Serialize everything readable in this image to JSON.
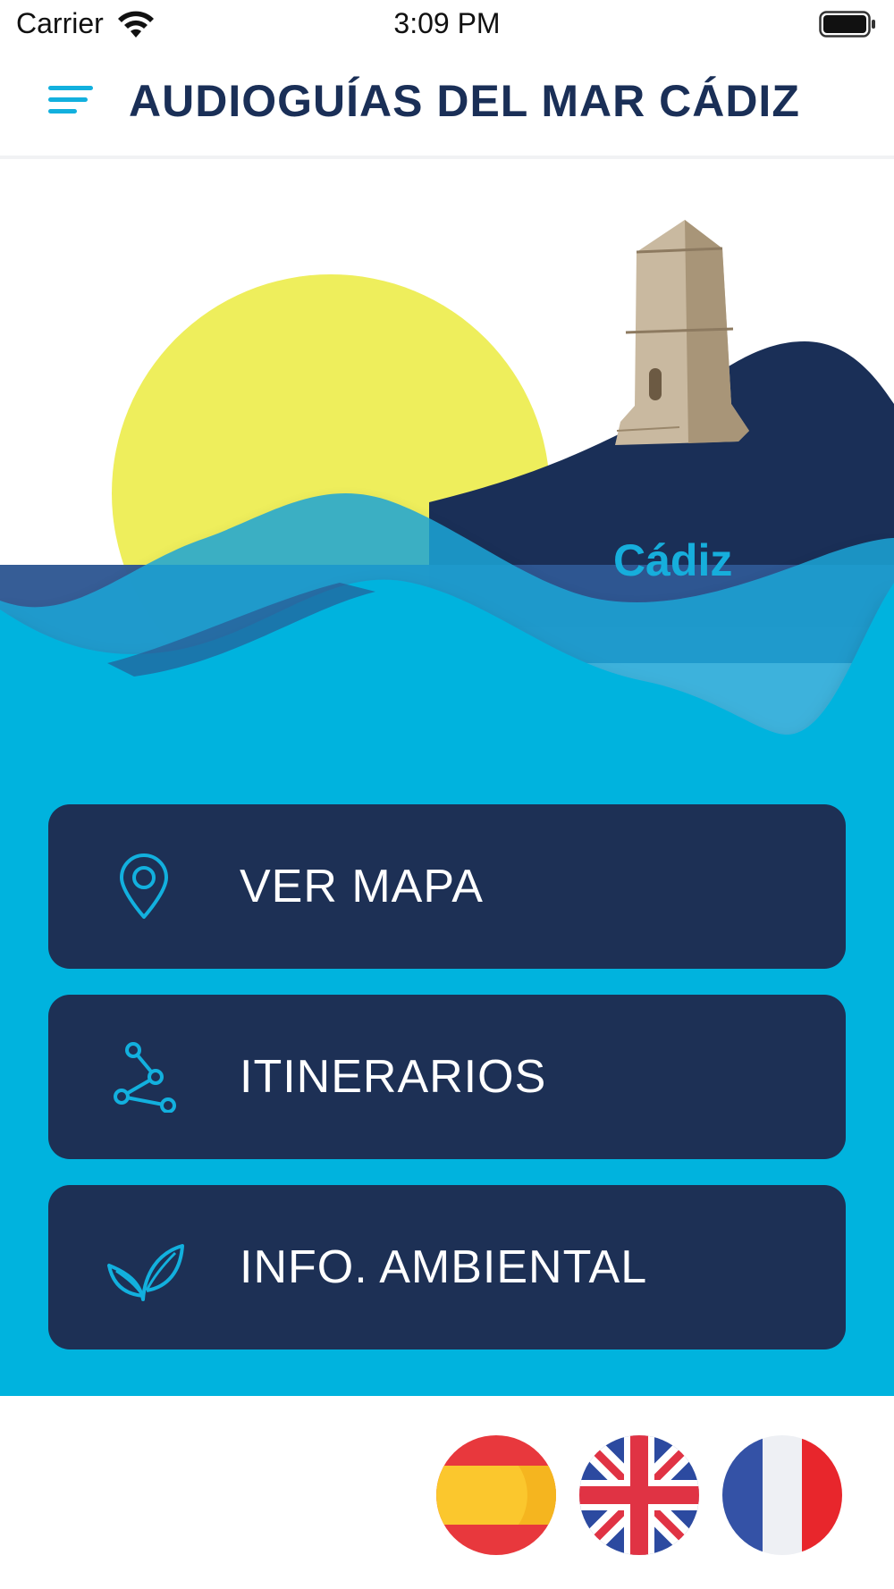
{
  "status_bar": {
    "carrier": "Carrier",
    "time": "3:09 PM",
    "icons": [
      "wifi-icon",
      "battery-icon"
    ]
  },
  "header": {
    "title": "AUDIOGUÍAS DEL MAR CÁDIZ",
    "menu_icon": "hamburger-menu-icon"
  },
  "hero": {
    "city": "Cádiz",
    "colors": {
      "sun": "#eeee5c",
      "hills": "#1a2f57",
      "sea_dark": "#2f5893",
      "sea_light": "#00b3de"
    }
  },
  "menu": [
    {
      "label": "VER MAPA",
      "icon": "map-pin-icon"
    },
    {
      "label": "ITINERARIOS",
      "icon": "route-icon"
    },
    {
      "label": "INFO. AMBIENTAL",
      "icon": "leaves-icon"
    }
  ],
  "languages": [
    {
      "flag": "spain-flag-icon"
    },
    {
      "flag": "uk-flag-icon"
    },
    {
      "flag": "france-flag-icon"
    }
  ],
  "colors": {
    "accent": "#12b0de",
    "primary_dark": "#1d3055",
    "title": "#1a2f57"
  }
}
